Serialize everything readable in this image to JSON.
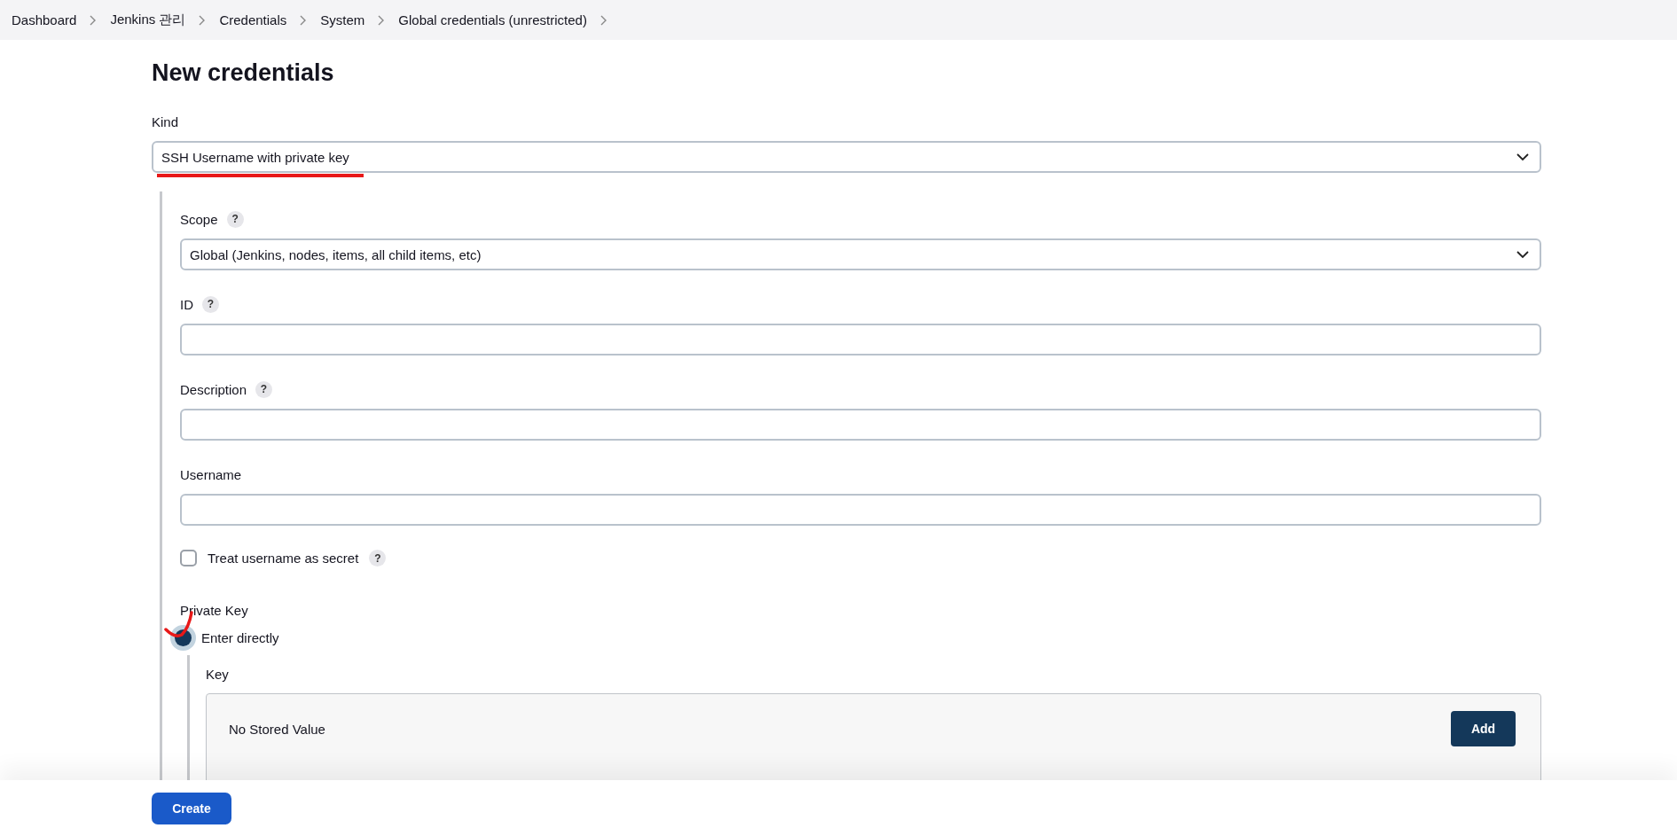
{
  "breadcrumbs": [
    "Dashboard",
    "Jenkins 관리",
    "Credentials",
    "System",
    "Global credentials (unrestricted)"
  ],
  "title": "New credentials",
  "kind_field": {
    "label": "Kind",
    "value": "SSH Username with private key"
  },
  "fields": [
    {
      "kind": "select",
      "label": "Scope",
      "help": "?",
      "value": "Global (Jenkins, nodes, items, all child items, etc)"
    },
    {
      "kind": "text",
      "label": "ID",
      "help": "?"
    },
    {
      "kind": "text",
      "label": "Description",
      "help": "?"
    },
    {
      "kind": "text",
      "label": "Username"
    },
    {
      "kind": "checkbox",
      "label": "Treat username as secret",
      "help": "?",
      "checked": false
    }
  ],
  "private_key": {
    "label": "Private Key",
    "options": [
      {
        "label": "Enter directly",
        "selected": true
      }
    ],
    "key": {
      "label": "Key",
      "status": "No Stored Value",
      "button": "Add"
    }
  },
  "create_button": "Create"
}
